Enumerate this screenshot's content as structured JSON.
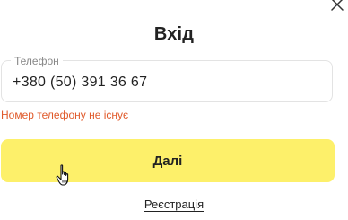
{
  "dialog": {
    "title": "Вхід",
    "close_icon": "close-icon"
  },
  "phone_field": {
    "label": "Телефон",
    "value": "+380 (50) 391 36 67",
    "error": "Номер телефону не існує"
  },
  "actions": {
    "next_label": "Далі",
    "register_label": "Реєстрація"
  },
  "colors": {
    "accent": "#fdf06a",
    "error": "#e05a2b"
  }
}
